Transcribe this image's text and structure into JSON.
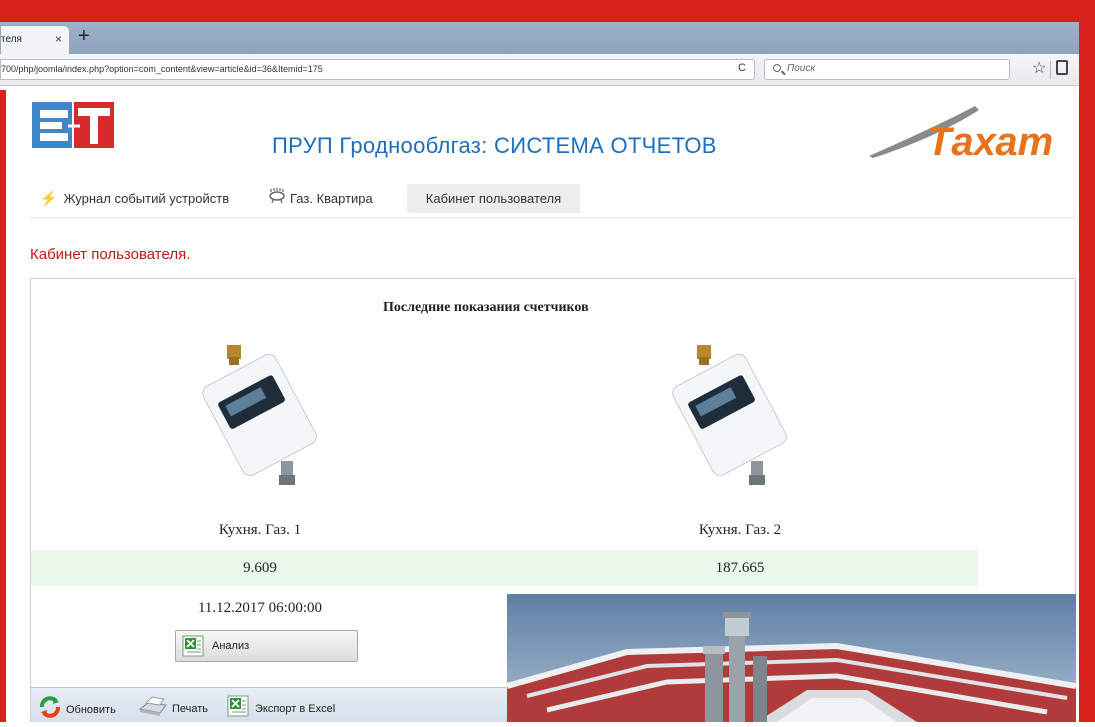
{
  "browser": {
    "tab_title": "теля",
    "tab_close": "×",
    "new_tab": "+",
    "url": "700/php/joomla/index.php?option=com_content&view=article&id=36&Itemid=175",
    "reload": "C",
    "search_placeholder": "Поиск",
    "bookmark": "☆"
  },
  "header": {
    "logo_left": "EST",
    "title": "ПРУП Гроднооблгаз: СИСТЕМА ОТЧЕТОВ",
    "logo_right": "Тахат"
  },
  "nav": {
    "items": [
      {
        "label": "Журнал событий устройств",
        "icon": "lightning-icon"
      },
      {
        "label": "Газ. Квартира",
        "icon": "gas-stove-icon"
      },
      {
        "label": "Кабинет пользователя",
        "active": true
      }
    ]
  },
  "page": {
    "heading": "Кабинет пользователя."
  },
  "panel": {
    "title": "Последние показания счетчиков",
    "meters": [
      {
        "name": "Кухня. Газ. 1",
        "value": "9.609"
      },
      {
        "name": "Кухня. Газ. 2",
        "value": "187.665"
      }
    ],
    "date": "11.12.2017 06:00:00",
    "analysis_button": "Анализ"
  },
  "toolbar": {
    "refresh": "Обновить",
    "print": "Печать",
    "export": "Экспорт в Excel"
  },
  "colors": {
    "frame_red": "#d8201c",
    "title_blue": "#1b6fbe",
    "heading_red": "#c01818",
    "value_row_bg": "#e9f8ea"
  }
}
